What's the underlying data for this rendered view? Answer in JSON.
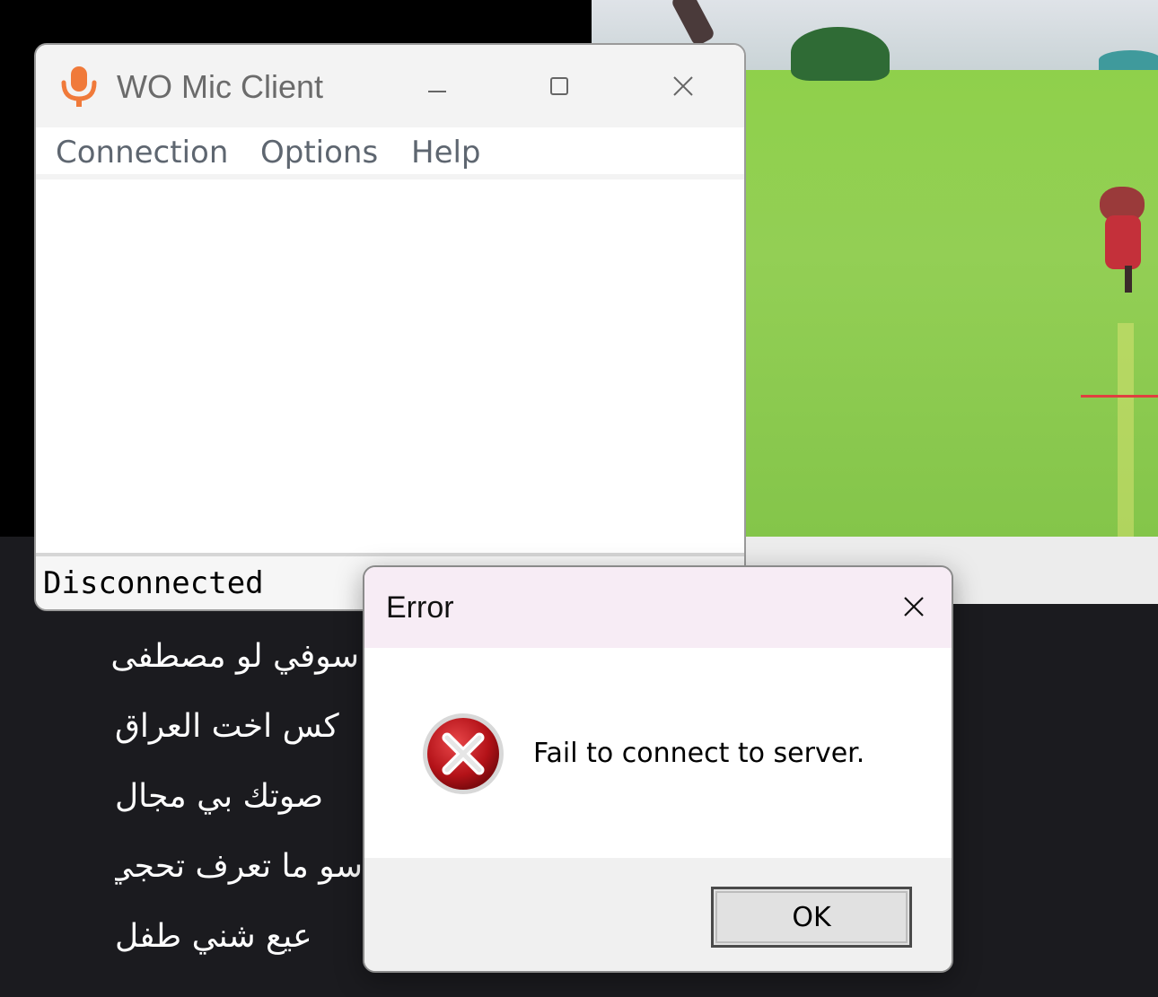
{
  "main_window": {
    "title": "WO Mic Client",
    "menu": [
      "Connection",
      "Options",
      "Help"
    ],
    "status": "Disconnected",
    "icon": "microphone-icon",
    "accent": "#f07a3a"
  },
  "error_dialog": {
    "title": "Error",
    "message": "Fail to connect to server.",
    "ok_label": "OK",
    "icon": "error-icon"
  },
  "chat_lines": [
    "سوفي لو مصطفى",
    "كس اخت العراق",
    "صوتك بي مجال",
    "سو ما تعرف تحجي",
    "عيع شني طفل"
  ]
}
